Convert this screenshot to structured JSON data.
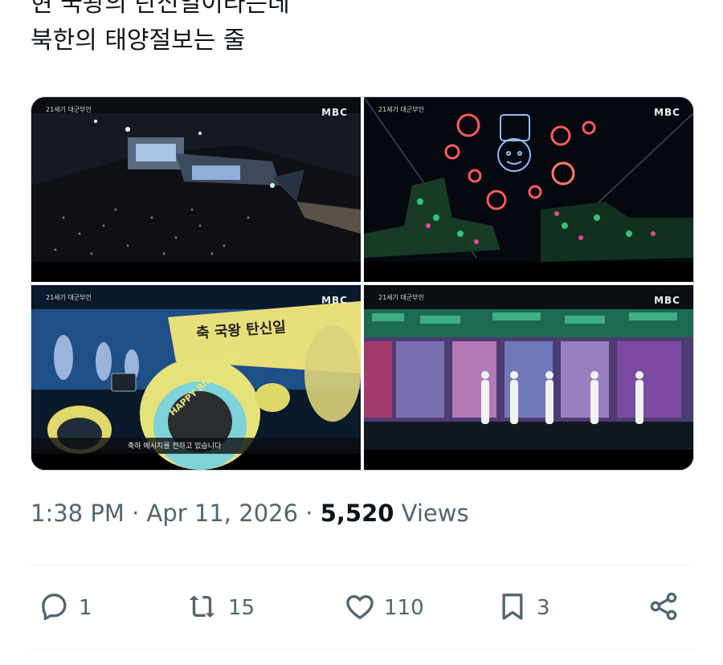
{
  "tweet": {
    "lines": [
      "현 국왕의 탄신일이라는데",
      "북한의 태양절보는 줄"
    ]
  },
  "media": [
    {
      "caption": "21세기 대군부인",
      "logo": "MBC"
    },
    {
      "caption": "21세기 대군부인",
      "logo": "MBC"
    },
    {
      "caption": "21세기 대군부인",
      "logo": "MBC",
      "banner": "축 국왕 탄신일",
      "ribbon": "HAPPY BIRTHDAY",
      "subtitle": "축하 메시지를 전하고 있습니다"
    },
    {
      "caption": "21세기 대군부인",
      "logo": "MBC"
    }
  ],
  "meta": {
    "time": "1:38 PM",
    "sep": "·",
    "date": "Apr 11, 2026",
    "views_count": "5,520",
    "views_label": "Views"
  },
  "actions": {
    "reply": "1",
    "retweet": "15",
    "like": "110",
    "bookmark": "3"
  }
}
